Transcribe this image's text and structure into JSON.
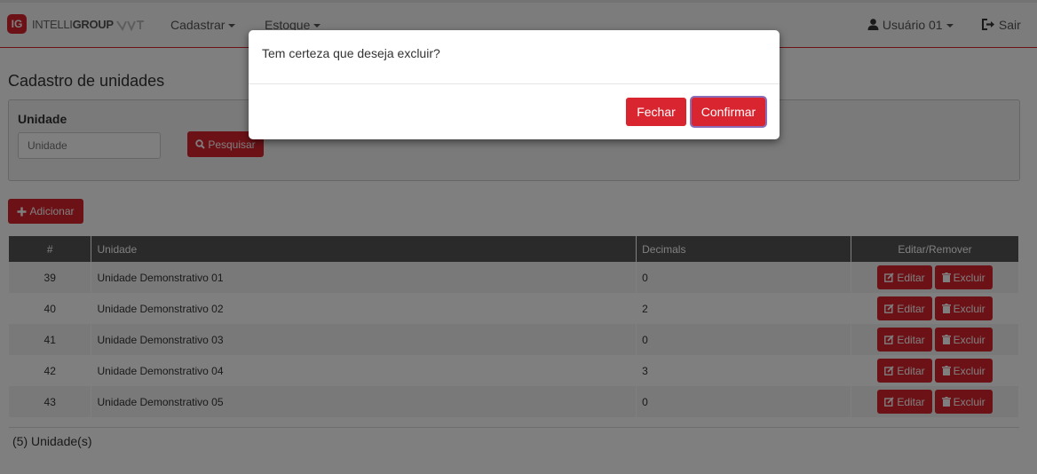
{
  "colors": {
    "accent": "#d9252f",
    "header_bg": "#555555"
  },
  "navbar": {
    "brand_mark": "IG",
    "brand_text_light": "INTELLI",
    "brand_text_bold": "GROUP",
    "menu": [
      {
        "label": "Cadastrar",
        "icon": "caret-down-icon"
      },
      {
        "label": "Estoque",
        "icon": "caret-down-icon"
      }
    ],
    "user": {
      "label": "Usuário 01",
      "icon": "user-icon"
    },
    "logout": {
      "label": "Sair",
      "icon": "sign-out-icon"
    }
  },
  "page": {
    "title": "Cadastro de unidades"
  },
  "filter": {
    "label": "Unidade",
    "input_placeholder": "Unidade",
    "search_label": "Pesquisar",
    "search_icon": "search-icon"
  },
  "add_button": {
    "label": "Adicionar",
    "icon": "plus-icon"
  },
  "table": {
    "headers": [
      "#",
      "Unidade",
      "Decimals",
      "Editar/Remover"
    ],
    "rows": [
      {
        "id": "39",
        "name": "Unidade Demonstrativo 01",
        "decimals": "0"
      },
      {
        "id": "40",
        "name": "Unidade Demonstrativo 02",
        "decimals": "2"
      },
      {
        "id": "41",
        "name": "Unidade Demonstrativo 03",
        "decimals": "0"
      },
      {
        "id": "42",
        "name": "Unidade Demonstrativo 04",
        "decimals": "3"
      },
      {
        "id": "43",
        "name": "Unidade Demonstrativo 05",
        "decimals": "0"
      }
    ],
    "edit_label": "Editar",
    "delete_label": "Excluir"
  },
  "footer": {
    "count": "(5) Unidade(s)"
  },
  "modal": {
    "message": "Tem certeza que deseja excluir?",
    "close_label": "Fechar",
    "confirm_label": "Confirmar"
  }
}
